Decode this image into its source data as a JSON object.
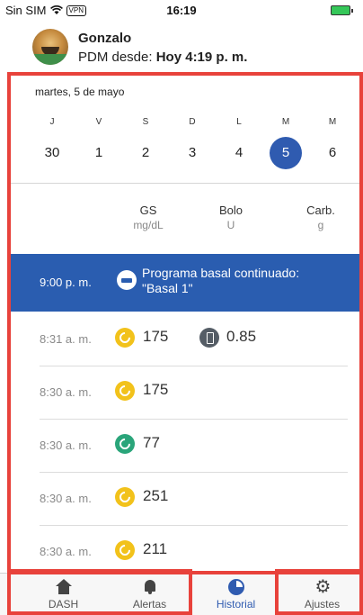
{
  "status_bar": {
    "carrier": "Sin SIM",
    "vpn_badge": "VPN",
    "time": "16:19"
  },
  "header": {
    "user_name": "Gonzalo",
    "pdm_label": "PDM desde: ",
    "pdm_value": "Hoy 4:19 p. m."
  },
  "calendar": {
    "date_label": "martes, 5 de mayo",
    "days": [
      {
        "letter": "J",
        "number": "30"
      },
      {
        "letter": "V",
        "number": "1"
      },
      {
        "letter": "S",
        "number": "2"
      },
      {
        "letter": "D",
        "number": "3"
      },
      {
        "letter": "L",
        "number": "4"
      },
      {
        "letter": "M",
        "number": "5",
        "selected": true
      },
      {
        "letter": "M",
        "number": "6"
      }
    ]
  },
  "columns": {
    "gs": {
      "label": "GS",
      "unit": "mg/dL"
    },
    "bolo": {
      "label": "Bolo",
      "unit": "U"
    },
    "carb": {
      "label": "Carb.",
      "unit": "g"
    }
  },
  "basal_event": {
    "time": "9:00 p. m.",
    "line1": "Programa basal continuado:",
    "line2": "\"Basal 1\""
  },
  "entries": [
    {
      "time": "8:31 a. m.",
      "gs": "175",
      "gs_color": "#f2c21b",
      "bolus": "0.85"
    },
    {
      "time": "8:30 a. m.",
      "gs": "175",
      "gs_color": "#f2c21b"
    },
    {
      "time": "8:30 a. m.",
      "gs": "77",
      "gs_color": "#2aa57a"
    },
    {
      "time": "8:30 a. m.",
      "gs": "251",
      "gs_color": "#f2c21b"
    },
    {
      "time": "8:30 a. m.",
      "gs": "211",
      "gs_color": "#f2c21b"
    }
  ],
  "tabs": [
    {
      "label": "DASH",
      "icon": "home-icon"
    },
    {
      "label": "Alertas",
      "icon": "bell-icon"
    },
    {
      "label": "Historial",
      "icon": "history-icon",
      "active": true
    },
    {
      "label": "Ajustes",
      "icon": "gear-icon"
    }
  ],
  "colors": {
    "accent": "#2f5bb0",
    "highlight": "#e8423b"
  }
}
